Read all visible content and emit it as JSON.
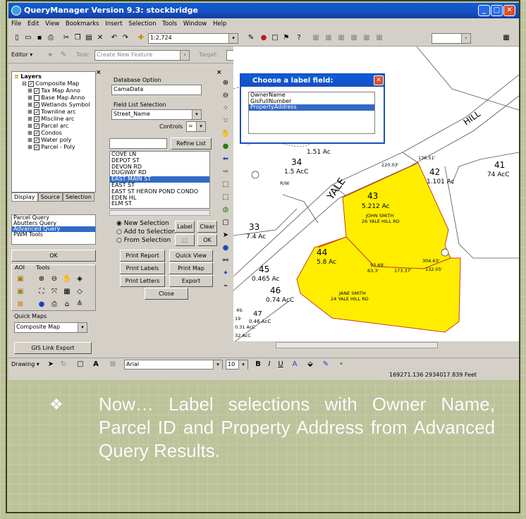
{
  "window": {
    "title": "QueryManager Version 9.3: stockbridge",
    "menu": [
      "File",
      "Edit",
      "View",
      "Bookmarks",
      "Insert",
      "Selection",
      "Tools",
      "Window",
      "Help"
    ],
    "scale": "1:2,724",
    "editor_label": "Editor ▾",
    "task_label": "Task:",
    "task_value": "Create New Feature",
    "target_label": "Target:"
  },
  "layers": {
    "title": "Layers",
    "root": "Composite Map",
    "items": [
      "Tax Map Anno",
      "Base Map Anno",
      "Wetlands Symbol",
      "Townline arc",
      "Miscline arc",
      "Parcel arc",
      "Condos",
      "Water poly",
      "Parcel - Poly"
    ]
  },
  "tabs": [
    "Display",
    "Source",
    "Selection"
  ],
  "queries": {
    "items": [
      "Parcel Query",
      "Abutters Query",
      "Advanced Query",
      "PWM Tools"
    ],
    "selected": "Advanced Query",
    "ok": "OK"
  },
  "aoi": {
    "aoi_label": "AOI",
    "tools_label": "Tools"
  },
  "quick_maps": {
    "label": "Quick Maps",
    "value": "Composite Map"
  },
  "gis_link": "GIS Link Export",
  "db": {
    "label": "Database Option",
    "value": "CamaData",
    "field_label": "Field List Selection",
    "field_value": "Street_Name",
    "controls_label": "Controls",
    "controls_value": "=",
    "refine": "Refine List",
    "streets": [
      "COVE LN",
      "DEPOT ST",
      "DEVON RD",
      "DUGWAY RD",
      "EAST MAIN ST",
      "EAST ST",
      "EAST ST HERON POND CONDO",
      "EDEN HL",
      "ELM ST"
    ],
    "selected_street": "EAST MAIN ST"
  },
  "selection": {
    "options": [
      "New Selection",
      "Add to Selection",
      "From Selection"
    ],
    "label_btn": "Label",
    "clear_btn": "Clear",
    "ok_btn": "OK"
  },
  "actions": {
    "print_report": "Print Report",
    "quick_view": "Quick View",
    "print_labels": "Print Labels",
    "print_map": "Print Map",
    "print_letters": "Print Letters",
    "export": "Export",
    "close": "Close"
  },
  "label_dialog": {
    "title": "Choose a label field:",
    "fields": [
      "OwnerName",
      "GisFullNumber",
      "PropertyAddress"
    ],
    "selected": "PropertyAddress"
  },
  "map": {
    "road": "YALE",
    "road2": "HILL",
    "parcels": [
      {
        "id": "43",
        "area": "5.212 Ac",
        "owner": "JOHN SMITH",
        "addr": "26 YALE HILL RD"
      },
      {
        "id": "44",
        "area": "5.8 Ac"
      },
      {
        "id": "42",
        "area": "1.101 Ac"
      },
      {
        "id": "41",
        "area": "74 AcC"
      },
      {
        "id": "34",
        "area": "1.5 AcC"
      },
      {
        "id": "33",
        "area": "7.4 Ac"
      },
      {
        "id": "45",
        "area": "0.465 Ac"
      },
      {
        "id": "46",
        "area": "0.74 AcC"
      },
      {
        "id": "47",
        "area": "0.46 AcC"
      }
    ],
    "owner2": "JANE SMITH",
    "addr2": "24 YALE HILL RD",
    "labels": {
      "ac151": "1.51 Ac",
      "d220": "220.03'",
      "d138": "136.51'",
      "d304": "304.63'",
      "d173": "173.37'",
      "d132": "132.05'",
      "d93": "93.69'",
      "d63": "63.3'",
      "row": "R/W",
      "ac49": "49.",
      "ac031": "0.31 AcC",
      "ac32": "32 AcC",
      "ac19": "19"
    }
  },
  "drawing": {
    "label": "Drawing ▾",
    "font": "Arial",
    "size": "10"
  },
  "status": {
    "coords": "169271.136  2934017.839 Feet"
  },
  "caption": {
    "bullet": "❖",
    "text": "Now… Label selections with Owner Name, Parcel ID and Property Address from Advanced Query Results."
  },
  "colors": {
    "selected_parcel": "#ffee00",
    "title_blue": "#1a4ec0",
    "slide_bg": "#bcc39a"
  }
}
